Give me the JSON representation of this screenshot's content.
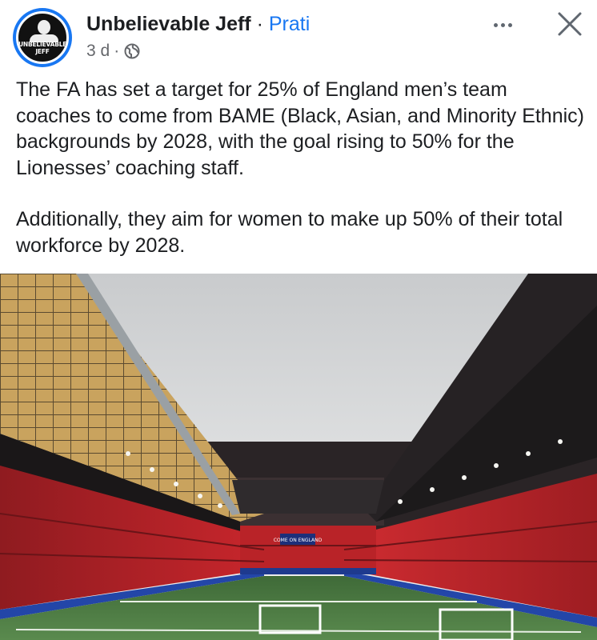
{
  "post": {
    "author": "Unbelievable Jeff",
    "separator": "·",
    "follow_label": "Prati",
    "timestamp": "3 d",
    "meta_separator": "·",
    "privacy_icon": "globe-icon",
    "avatar_text": "UNBELIEVABLE\nJEFF",
    "paragraphs": [
      "The FA has set a target for 25% of England men’s team coaches to come from BAME (Black, Asian, and Minority Ethnic) backgrounds by 2028, with the goal rising to 50% for the Lionesses’ coaching staff.",
      "Additionally, they aim for women to make up 50% of their total workforce by 2028."
    ],
    "image": {
      "description_icon": "stadium-photo",
      "scoreboard_text": "COME ON ENGLAND"
    }
  },
  "actions": {
    "more_icon": "more-dots-icon",
    "close_icon": "close-icon"
  },
  "colors": {
    "accent": "#1877f2",
    "text": "#1c1e21",
    "secondary": "#65676b",
    "seats": "#c8262c",
    "pitch": "#4f7a45"
  }
}
